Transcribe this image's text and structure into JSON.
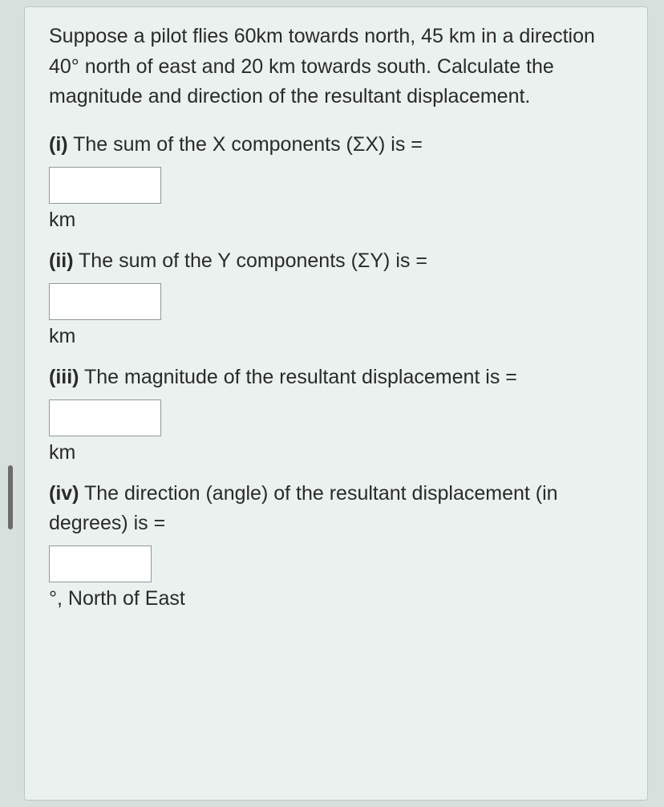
{
  "question": {
    "prompt": "Suppose a pilot flies 60km towards north, 45 km in a direction 40° north of east and 20 km towards south. Calculate the magnitude and direction of the resultant displacement.",
    "parts": [
      {
        "label": "(i)",
        "text": " The sum of the X components (ΣX) is =",
        "input_value": "",
        "unit": "km"
      },
      {
        "label": "(ii)",
        "text": " The sum of the Y components (ΣY) is =",
        "input_value": "",
        "unit": "km"
      },
      {
        "label": "(iii)",
        "text": " The magnitude of the resultant displacement is =",
        "input_value": "",
        "unit": "km"
      },
      {
        "label": "(iv)",
        "text": " The direction (angle) of the resultant displacement (in degrees) is =",
        "input_value": "",
        "unit": "°, North of East"
      }
    ]
  }
}
